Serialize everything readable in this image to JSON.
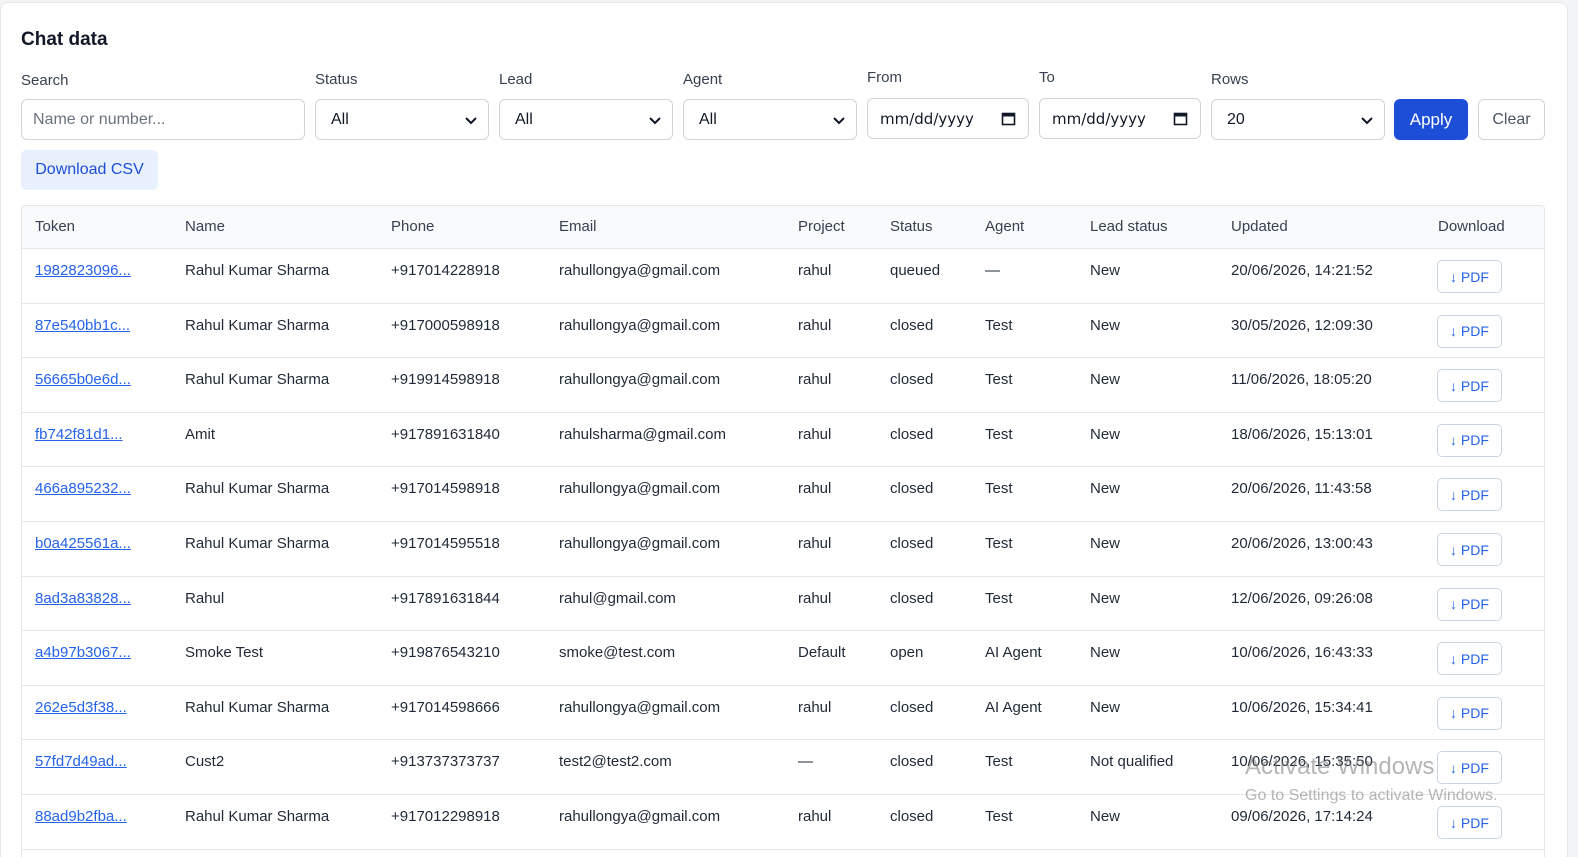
{
  "page": {
    "title": "Chat data"
  },
  "filters": {
    "search_label": "Search",
    "search_placeholder": "Name or number...",
    "status_label": "Status",
    "status_value": "All",
    "lead_label": "Lead",
    "lead_value": "All",
    "agent_label": "Agent",
    "agent_value": "All",
    "from_label": "From",
    "from_value": "mm/dd/yyyy",
    "to_label": "To",
    "to_value": "mm/dd/yyyy",
    "rows_label": "Rows",
    "rows_value": "20",
    "apply_label": "Apply",
    "clear_label": "Clear",
    "download_csv_label": "Download CSV"
  },
  "table": {
    "headers": [
      "Token",
      "Name",
      "Phone",
      "Email",
      "Project",
      "Status",
      "Agent",
      "Lead status",
      "Updated",
      "Download"
    ],
    "pdf_label": "↓ PDF",
    "rows": [
      [
        "1982823096...",
        "Rahul Kumar Sharma",
        "+917014228918",
        "rahullongya@gmail.com",
        "rahul",
        "queued",
        "—",
        "New",
        "20/06/2026, 14:21:52"
      ],
      [
        "87e540bb1c...",
        "Rahul Kumar Sharma",
        "+917000598918",
        "rahullongya@gmail.com",
        "rahul",
        "closed",
        "Test",
        "New",
        "30/05/2026, 12:09:30"
      ],
      [
        "56665b0e6d...",
        "Rahul Kumar Sharma",
        "+919914598918",
        "rahullongya@gmail.com",
        "rahul",
        "closed",
        "Test",
        "New",
        "11/06/2026, 18:05:20"
      ],
      [
        "fb742f81d1...",
        "Amit",
        "+917891631840",
        "rahulsharma@gmail.com",
        "rahul",
        "closed",
        "Test",
        "New",
        "18/06/2026, 15:13:01"
      ],
      [
        "466a895232...",
        "Rahul Kumar Sharma",
        "+917014598918",
        "rahullongya@gmail.com",
        "rahul",
        "closed",
        "Test",
        "New",
        "20/06/2026, 11:43:58"
      ],
      [
        "b0a425561a...",
        "Rahul Kumar Sharma",
        "+917014595518",
        "rahullongya@gmail.com",
        "rahul",
        "closed",
        "Test",
        "New",
        "20/06/2026, 13:00:43"
      ],
      [
        "8ad3a83828...",
        "Rahul",
        "+917891631844",
        "rahul@gmail.com",
        "rahul",
        "closed",
        "Test",
        "New",
        "12/06/2026, 09:26:08"
      ],
      [
        "a4b97b3067...",
        "Smoke Test",
        "+919876543210",
        "smoke@test.com",
        "Default",
        "open",
        "AI Agent",
        "New",
        "10/06/2026, 16:43:33"
      ],
      [
        "262e5d3f38...",
        "Rahul Kumar Sharma",
        "+917014598666",
        "rahullongya@gmail.com",
        "rahul",
        "closed",
        "AI Agent",
        "New",
        "10/06/2026, 15:34:41"
      ],
      [
        "57fd7d49ad...",
        "Cust2",
        "+913737373737",
        "test2@test2.com",
        "—",
        "closed",
        "Test",
        "Not qualified",
        "10/06/2026, 15:35:50"
      ],
      [
        "88ad9b2fba...",
        "Rahul Kumar Sharma",
        "+917012298918",
        "rahullongya@gmail.com",
        "rahul",
        "closed",
        "Test",
        "New",
        "09/06/2026, 17:14:24"
      ]
    ]
  },
  "watermark": {
    "line1": "Activate Windows",
    "line2": "Go to Settings to activate Windows."
  },
  "icons": {
    "select": "chevron-down-icon",
    "date": "calendar-icon",
    "download": "download-arrow-icon"
  },
  "colors": {
    "accent": "#1d4ed8",
    "link": "#2563eb",
    "csv_bg": "#e8f0fe"
  }
}
